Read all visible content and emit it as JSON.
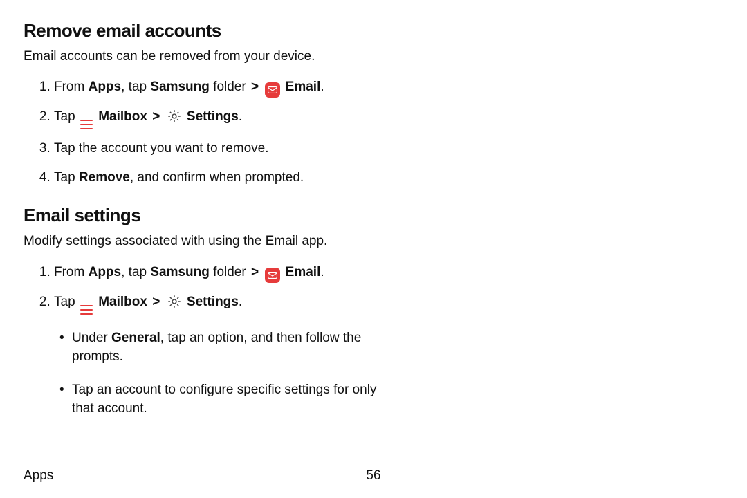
{
  "sections": [
    {
      "heading": "Remove email accounts",
      "intro": "Email accounts can be removed from your device.",
      "steps": [
        {
          "parts": [
            {
              "t": "text",
              "v": "From "
            },
            {
              "t": "bold",
              "v": "Apps"
            },
            {
              "t": "text",
              "v": ", tap "
            },
            {
              "t": "bold",
              "v": "Samsung"
            },
            {
              "t": "text",
              "v": " folder "
            },
            {
              "t": "chev",
              "v": ">"
            },
            {
              "t": "text",
              "v": " "
            },
            {
              "t": "email-icon"
            },
            {
              "t": "text",
              "v": " "
            },
            {
              "t": "bold",
              "v": "Email"
            },
            {
              "t": "text",
              "v": "."
            }
          ]
        },
        {
          "parts": [
            {
              "t": "text",
              "v": "Tap "
            },
            {
              "t": "hamburger-icon"
            },
            {
              "t": "text",
              "v": " "
            },
            {
              "t": "bold",
              "v": "Mailbox"
            },
            {
              "t": "text",
              "v": " "
            },
            {
              "t": "chev",
              "v": ">"
            },
            {
              "t": "text",
              "v": " "
            },
            {
              "t": "gear-icon"
            },
            {
              "t": "text",
              "v": " "
            },
            {
              "t": "bold",
              "v": "Settings"
            },
            {
              "t": "text",
              "v": "."
            }
          ]
        },
        {
          "parts": [
            {
              "t": "text",
              "v": "Tap the account you want to remove."
            }
          ]
        },
        {
          "parts": [
            {
              "t": "text",
              "v": "Tap "
            },
            {
              "t": "bold",
              "v": "Remove"
            },
            {
              "t": "text",
              "v": ", and confirm when prompted."
            }
          ]
        }
      ]
    },
    {
      "heading": "Email settings",
      "intro": "Modify settings associated with using the Email app.",
      "steps": [
        {
          "parts": [
            {
              "t": "text",
              "v": "From "
            },
            {
              "t": "bold",
              "v": "Apps"
            },
            {
              "t": "text",
              "v": ", tap "
            },
            {
              "t": "bold",
              "v": "Samsung"
            },
            {
              "t": "text",
              "v": " folder "
            },
            {
              "t": "chev",
              "v": ">"
            },
            {
              "t": "text",
              "v": " "
            },
            {
              "t": "email-icon"
            },
            {
              "t": "text",
              "v": " "
            },
            {
              "t": "bold",
              "v": "Email"
            },
            {
              "t": "text",
              "v": "."
            }
          ]
        },
        {
          "parts": [
            {
              "t": "text",
              "v": "Tap "
            },
            {
              "t": "hamburger-icon"
            },
            {
              "t": "text",
              "v": " "
            },
            {
              "t": "bold",
              "v": "Mailbox"
            },
            {
              "t": "text",
              "v": " "
            },
            {
              "t": "chev",
              "v": ">"
            },
            {
              "t": "text",
              "v": " "
            },
            {
              "t": "gear-icon"
            },
            {
              "t": "text",
              "v": " "
            },
            {
              "t": "bold",
              "v": "Settings"
            },
            {
              "t": "text",
              "v": "."
            }
          ],
          "sub": [
            {
              "parts": [
                {
                  "t": "text",
                  "v": "Under "
                },
                {
                  "t": "bold",
                  "v": "General"
                },
                {
                  "t": "text",
                  "v": ", tap an option, and then follow the prompts."
                }
              ]
            },
            {
              "parts": [
                {
                  "t": "text",
                  "v": "Tap an account to configure specific settings for only that account."
                }
              ]
            }
          ]
        }
      ]
    }
  ],
  "footer": {
    "section": "Apps",
    "page": "56"
  }
}
